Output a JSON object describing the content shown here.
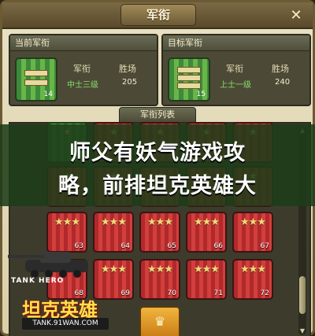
{
  "window": {
    "title": "军衔",
    "close": "✕"
  },
  "current_panel": {
    "header": "当前军衔",
    "rank_head": "军衔",
    "wins_head": "胜场",
    "rank_value": "中士三级",
    "wins_value": "205",
    "badge_number": "14"
  },
  "target_panel": {
    "header": "目标军衔",
    "rank_head": "军衔",
    "wins_head": "胜场",
    "rank_value": "上士一级",
    "wins_value": "240",
    "badge_number": "15"
  },
  "list": {
    "header": "军衔列表",
    "rows": [
      {
        "cells": [
          {
            "color": "green",
            "stars": "★",
            "number": ""
          },
          {
            "color": "red",
            "stars": "★",
            "number": ""
          },
          {
            "color": "red",
            "stars": "★",
            "number": ""
          },
          {
            "color": "red",
            "stars": "★",
            "number": ""
          },
          {
            "color": "red",
            "stars": "★",
            "number": ""
          }
        ]
      },
      {
        "cells": [
          {
            "color": "red",
            "stars": "★",
            "number": ""
          },
          {
            "color": "red",
            "stars": "★",
            "number": ""
          },
          {
            "color": "red",
            "stars": "★",
            "number": ""
          },
          {
            "color": "red",
            "stars": "★",
            "number": ""
          },
          {
            "color": "red",
            "stars": "★",
            "number": ""
          }
        ]
      },
      {
        "cells": [
          {
            "color": "red",
            "stars": "★★★",
            "number": "63"
          },
          {
            "color": "red",
            "stars": "★★★",
            "number": "64"
          },
          {
            "color": "red",
            "stars": "★★★",
            "number": "65"
          },
          {
            "color": "red",
            "stars": "★★★",
            "number": "66"
          },
          {
            "color": "red",
            "stars": "★★★",
            "number": "67"
          }
        ]
      },
      {
        "cells": [
          {
            "color": "red",
            "stars": "★★★",
            "number": "68"
          },
          {
            "color": "red",
            "stars": "★★★",
            "number": "69"
          },
          {
            "color": "red",
            "stars": "★★★",
            "number": "70"
          },
          {
            "color": "red",
            "stars": "★★★",
            "number": "71"
          },
          {
            "color": "red",
            "stars": "★★★",
            "number": "72"
          }
        ]
      }
    ],
    "special_emblem": "♛"
  },
  "overlay": {
    "line1": "师父有妖气游戏攻",
    "line2": "略，前排坦克英雄大"
  },
  "logo": {
    "en": "TANK HERO",
    "cn": "坦克英雄",
    "url": "TANK.91WAN.COM"
  },
  "colors": {
    "frame": "#6b5a33",
    "green_stripe": "#5da746",
    "red_stripe": "#d23f3c",
    "gold": "#f1b53d"
  }
}
